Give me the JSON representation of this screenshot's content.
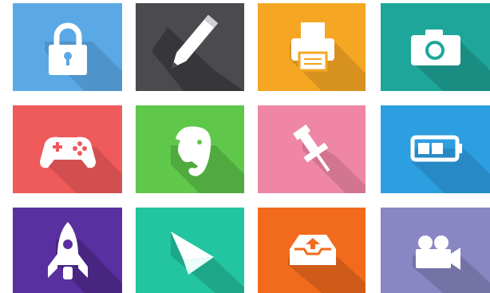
{
  "tiles": [
    {
      "icon": "lock-icon",
      "color": "#5aa9e6"
    },
    {
      "icon": "pencil-icon",
      "color": "#4a4a4f"
    },
    {
      "icon": "printer-icon",
      "color": "#f5a623"
    },
    {
      "icon": "camera-icon",
      "color": "#1fa69a"
    },
    {
      "icon": "gamepad-icon",
      "color": "#ef5a5a"
    },
    {
      "icon": "evernote-elephant-icon",
      "color": "#5fc84a"
    },
    {
      "icon": "pushpin-icon",
      "color": "#ef86a6"
    },
    {
      "icon": "battery-icon",
      "color": "#2d9ee0"
    },
    {
      "icon": "rocket-icon",
      "color": "#5a2fa0"
    },
    {
      "icon": "paper-plane-icon",
      "color": "#23c4a0"
    },
    {
      "icon": "inbox-upload-icon",
      "color": "#f26b1d"
    },
    {
      "icon": "video-camera-icon",
      "color": "#8a86c4"
    }
  ]
}
